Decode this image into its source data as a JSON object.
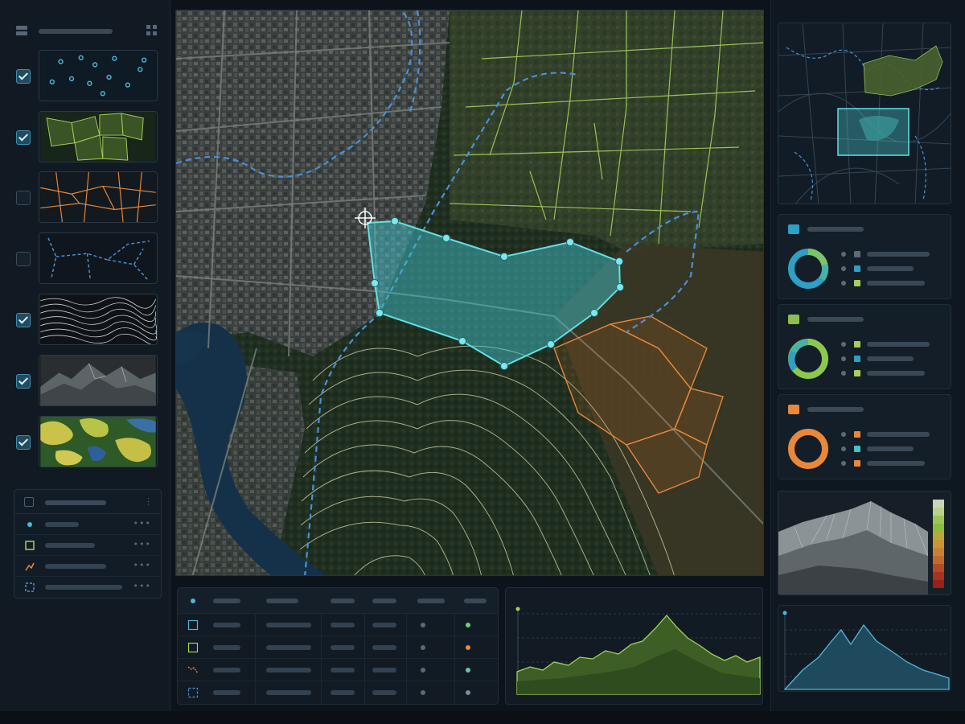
{
  "colors": {
    "accent_teal": "#4fd0d6",
    "parcel_green": "#a6cf5a",
    "road_orange": "#e8883a",
    "boundary_blue": "#4a90d9",
    "contour": "#d9d7a8",
    "panel_bg": "#121b24"
  },
  "sidebar": {
    "header_icons": [
      "grid-icon",
      "options-icon"
    ],
    "layers": [
      {
        "name": "points",
        "checked": true,
        "icon": "points-thumbnail"
      },
      {
        "name": "parcels",
        "checked": true,
        "icon": "parcels-thumbnail"
      },
      {
        "name": "roads",
        "checked": false,
        "icon": "roads-thumbnail"
      },
      {
        "name": "boundaries",
        "checked": false,
        "icon": "boundaries-thumbnail"
      },
      {
        "name": "contours",
        "checked": true,
        "icon": "contours-thumbnail"
      },
      {
        "name": "hillshade",
        "checked": true,
        "icon": "hillshade-thumbnail"
      },
      {
        "name": "landcover",
        "checked": true,
        "icon": "landcover-thumbnail"
      }
    ],
    "legend": {
      "items": [
        {
          "icon": "point-icon",
          "color": "#4fb8d6"
        },
        {
          "icon": "polygon-icon",
          "color": "#a6cf5a"
        },
        {
          "icon": "line-icon",
          "color": "#e8883a"
        },
        {
          "icon": "selection-icon",
          "color": "#4a90d9"
        }
      ]
    }
  },
  "map": {
    "selection_polygon_color": "#4fd0d6",
    "crosshair_icon": "crosshair-icon"
  },
  "table": {
    "row_icons": [
      "polygon-outline-icon",
      "parcel-icon",
      "line-icon",
      "selection-icon"
    ],
    "status_colors": [
      "#6fcf7a",
      "#e8883a",
      "#5fc9a4",
      "#7d8c98"
    ]
  },
  "right_panel": {
    "stats": [
      {
        "swatch": "#2f9fc4",
        "donut_colors": [
          "#2f9fc4",
          "#46b3a6",
          "#7cc46a"
        ],
        "legend_colors": [
          "#5b6a76",
          "#2f9fc4",
          "#a6cf5a"
        ]
      },
      {
        "swatch": "#8cbf4f",
        "donut_colors": [
          "#8cc84f",
          "#46b3a6",
          "#2f9fc4"
        ],
        "legend_colors": [
          "#a6cf5a",
          "#2f9fc4",
          "#a6cf5a"
        ]
      },
      {
        "swatch": "#e8883a",
        "donut_colors": [
          "#e8883a"
        ],
        "legend_colors": [
          "#e8883a",
          "#46c1c4",
          "#e8883a"
        ]
      }
    ],
    "elevation_ramp": [
      "#c9d5b8",
      "#b8d28a",
      "#9bc653",
      "#8cbc3f",
      "#b8a83a",
      "#c99535",
      "#c98030",
      "#c26a2b",
      "#b34b27",
      "#a8331f",
      "#9b1f1a"
    ]
  }
}
